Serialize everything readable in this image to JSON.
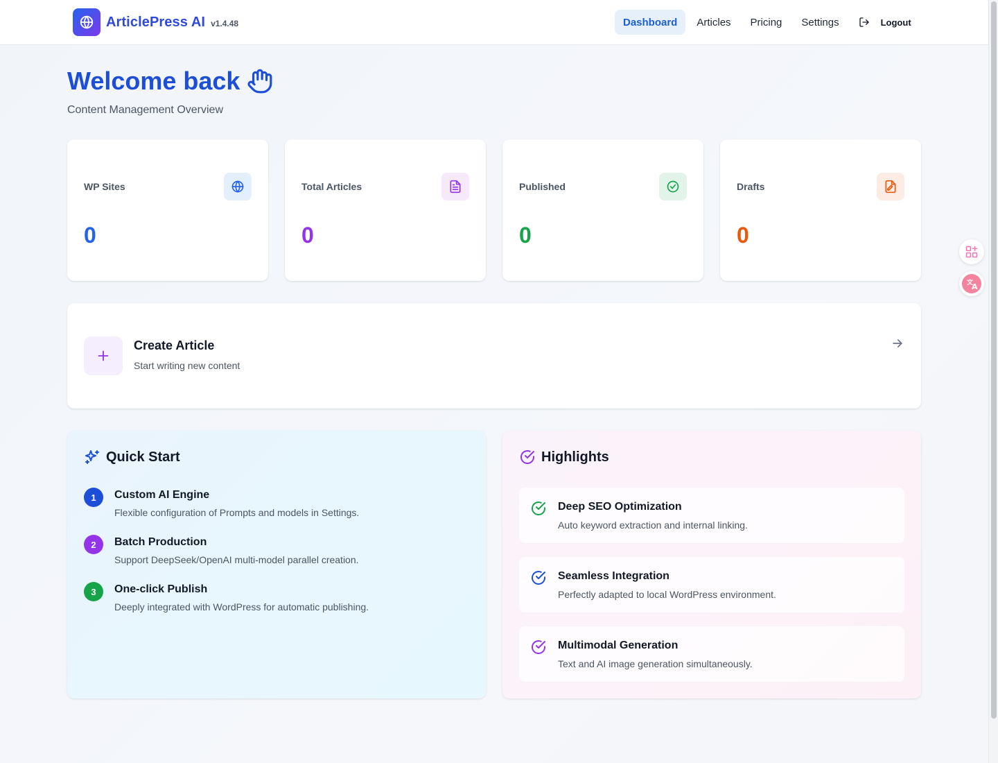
{
  "header": {
    "brand_name": "ArticlePress AI",
    "version": "v1.4.48",
    "nav": [
      {
        "label": "Dashboard",
        "active": true
      },
      {
        "label": "Articles",
        "active": false
      },
      {
        "label": "Pricing",
        "active": false
      },
      {
        "label": "Settings",
        "active": false
      }
    ],
    "logout_label": "Logout"
  },
  "welcome": {
    "title": "Welcome back",
    "subtitle": "Content Management Overview"
  },
  "stats": [
    {
      "label": "WP Sites",
      "value": "0",
      "icon": "globe-icon",
      "color": "#2563eb",
      "bg": "#e3f0fb"
    },
    {
      "label": "Total Articles",
      "value": "0",
      "icon": "document-icon",
      "color": "#9333ea",
      "bg": "#f6e9fb"
    },
    {
      "label": "Published",
      "value": "0",
      "icon": "check-circle-icon",
      "color": "#16a34a",
      "bg": "#e2f4ea"
    },
    {
      "label": "Drafts",
      "value": "0",
      "icon": "draft-file-icon",
      "color": "#ea580c",
      "bg": "#fdece4"
    }
  ],
  "create_article": {
    "title": "Create Article",
    "subtitle": "Start writing new content"
  },
  "quick_start": {
    "title": "Quick Start",
    "steps": [
      {
        "num": "1",
        "title": "Custom AI Engine",
        "desc": "Flexible configuration of Prompts and models in Settings.",
        "color": "#1d4ed8"
      },
      {
        "num": "2",
        "title": "Batch Production",
        "desc": "Support DeepSeek/OpenAI multi-model parallel creation.",
        "color": "#9333ea"
      },
      {
        "num": "3",
        "title": "One-click Publish",
        "desc": "Deeply integrated with WordPress for automatic publishing.",
        "color": "#16a34a"
      }
    ]
  },
  "highlights": {
    "title": "Highlights",
    "items": [
      {
        "title": "Deep SEO Optimization",
        "desc": "Auto keyword extraction and internal linking.",
        "color": "#16a34a"
      },
      {
        "title": "Seamless Integration",
        "desc": "Perfectly adapted to local WordPress environment.",
        "color": "#1d4ed8"
      },
      {
        "title": "Multimodal Generation",
        "desc": "Text and AI image generation simultaneously.",
        "color": "#9333ea"
      }
    ]
  },
  "floating_tools": [
    {
      "icon": "apps-sparkle-icon"
    },
    {
      "icon": "translate-icon"
    }
  ]
}
